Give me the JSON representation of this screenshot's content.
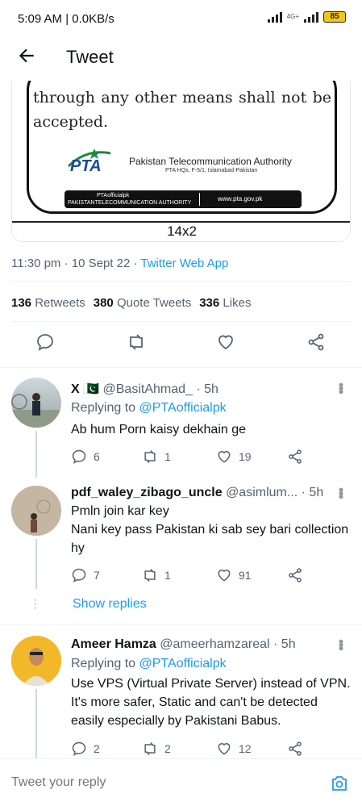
{
  "status": {
    "time_text": "5:09 AM | 0.0KB/s",
    "net_label": "4G+",
    "battery": "85"
  },
  "header": {
    "title": "Tweet",
    "back_icon": "arrow-left-icon"
  },
  "media": {
    "poster_text": "through any other means shall not be accepted.",
    "org_logo_text": "PTA",
    "org_name": "Pakistan Telecommunication Authority",
    "org_address": "PTA HQs, F-5/1, Islamabad-Pakistan",
    "social_handle": "PTAofficialpk",
    "social_name": "PAKISTANTELECOMMUNICATION AUTHORITY",
    "website": "www.pta.gov.pk",
    "caption": "14x2"
  },
  "tweet": {
    "timestamp": "11:30 pm · 10 Sept 22 · ",
    "source": "Twitter Web App",
    "retweets_count": "136",
    "retweets_label": "Retweets",
    "quotes_count": "380",
    "quotes_label": "Quote Tweets",
    "likes_count": "336",
    "likes_label": "Likes"
  },
  "replies": [
    {
      "name": "X",
      "flag": "🇵🇰",
      "handle": "@BasitAhmad_",
      "time": "· 5h",
      "replying_to_label": "Replying to ",
      "replying_to": "@PTAofficialpk",
      "text": "Ab hum Porn kaisy dekhain ge",
      "reply_count": "6",
      "retweet_count": "1",
      "like_count": "19"
    },
    {
      "name": "pdf_waley_zibago_uncle",
      "handle": "@asimlum...",
      "time": "· 5h",
      "text": "Pmln join kar key\nNani key pass Pakistan ki sab sey bari collection hy",
      "reply_count": "7",
      "retweet_count": "1",
      "like_count": "91",
      "show_replies": "Show replies"
    },
    {
      "name": "Ameer Hamza",
      "handle": "@ameerhamzareal",
      "time": "· 5h",
      "replying_to_label": "Replying to ",
      "replying_to": "@PTAofficialpk",
      "text": "Use VPS (Virtual Private Server) instead of VPN. It's more safer, Static and can't be detected easily especially by Pakistani Babus.",
      "reply_count": "2",
      "retweet_count": "2",
      "like_count": "12"
    }
  ],
  "composer": {
    "placeholder": "Tweet your reply"
  },
  "colors": {
    "accent": "#1d9bf0",
    "muted": "#536471",
    "text": "#0f1419"
  }
}
